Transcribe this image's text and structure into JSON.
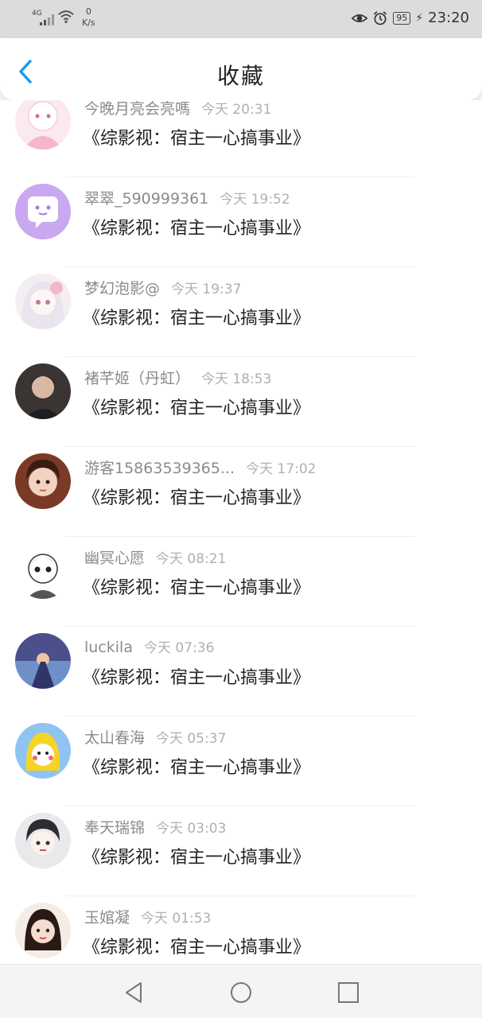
{
  "status_bar": {
    "network": "4G",
    "speed_value": "0",
    "speed_unit": "K/s",
    "battery": "95",
    "time": "23:20",
    "icons": [
      "signal-icon",
      "wifi-icon",
      "eye-icon",
      "alarm-icon",
      "battery-icon",
      "charging-icon"
    ]
  },
  "header": {
    "title": "收藏",
    "back_icon": "chevron-left-icon",
    "accent_color": "#1e9be8"
  },
  "items": [
    {
      "user": "今晚月亮会亮嗎",
      "time": "今天 20:31",
      "book": "《综影视：宿主一心搞事业》"
    },
    {
      "user": "翠翠_590999361",
      "time": "今天 19:52",
      "book": "《综影视：宿主一心搞事业》"
    },
    {
      "user": "梦幻泡影@",
      "time": "今天 19:37",
      "book": "《综影视：宿主一心搞事业》"
    },
    {
      "user": "褚芊姬（丹虹）",
      "time": "今天 18:53",
      "book": "《综影视：宿主一心搞事业》"
    },
    {
      "user": "游客15863539365...",
      "time": "今天 17:02",
      "book": "《综影视：宿主一心搞事业》"
    },
    {
      "user": "幽冥心愿",
      "time": "今天 08:21",
      "book": "《综影视：宿主一心搞事业》"
    },
    {
      "user": "luckila",
      "time": "今天 07:36",
      "book": "《综影视：宿主一心搞事业》"
    },
    {
      "user": "太山春海",
      "time": "今天 05:37",
      "book": "《综影视：宿主一心搞事业》"
    },
    {
      "user": "奉天瑞锦",
      "time": "今天 03:03",
      "book": "《综影视：宿主一心搞事业》"
    },
    {
      "user": "玉婠凝",
      "time": "今天 01:53",
      "book": "《综影视：宿主一心搞事业》"
    }
  ],
  "nav": {
    "icons": [
      "back-triangle-icon",
      "home-circle-icon",
      "recents-square-icon"
    ]
  }
}
